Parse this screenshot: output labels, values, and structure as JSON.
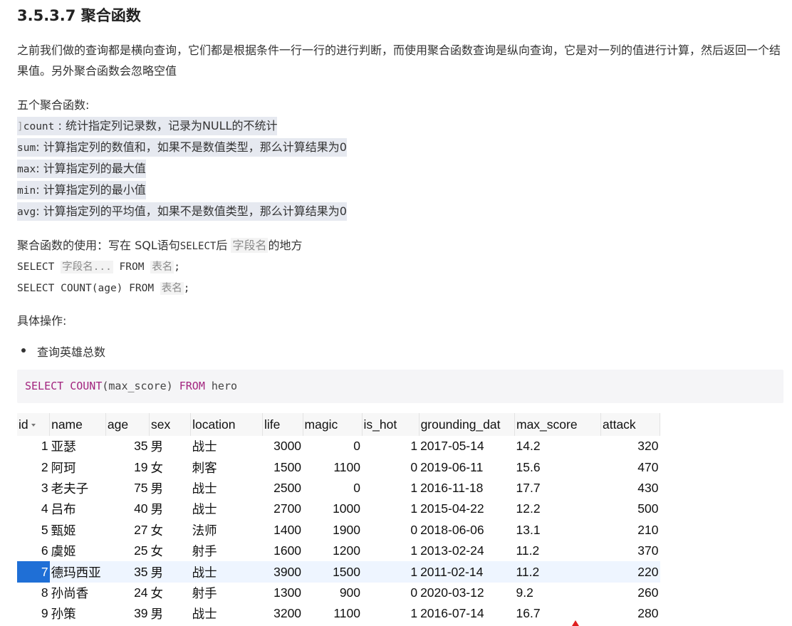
{
  "heading": "3.5.3.7 聚合函数",
  "intro": "之前我们做的查询都是横向查询，它们都是根据条件一行一行的进行判断，而使用聚合函数查询是纵向查询，它是对一列的值进行计算，然后返回一个结果值。另外聚合函数会忽略空值",
  "five_title": "五个聚合函数:",
  "functions": [
    {
      "name": "count",
      "sep": " :  ",
      "desc": "统计指定列记录数，记录为NULL的不统计"
    },
    {
      "name": "sum",
      "sep": ": ",
      "desc": "计算指定列的数值和，如果不是数值类型，那么计算结果为0"
    },
    {
      "name": "max",
      "sep": ": ",
      "desc": "计算指定列的最大值"
    },
    {
      "name": "min",
      "sep": ": ",
      "desc": "计算指定列的最小值"
    },
    {
      "name": "avg",
      "sep": ": ",
      "desc": "计算指定列的平均值，如果不是数值类型，那么计算结果为0"
    }
  ],
  "usage": {
    "prefix": "聚合函数的使用：写在 SQL语句",
    "select_kw": "SELECT",
    "after": "后 ",
    "field": "字段名",
    "suffix": "的地方"
  },
  "syntax1": {
    "select": "SELECT ",
    "fields": "字段名...",
    "from": " FROM ",
    "table": "表名",
    "end": ";"
  },
  "syntax2": {
    "select": "SELECT COUNT(age) FROM ",
    "table": "表名",
    "end": ";"
  },
  "ops_title": "具体操作:",
  "bullet": "查询英雄总数",
  "code": {
    "kw1": "SELECT",
    "fn": "COUNT",
    "arg": "(max_score) ",
    "kw2": "FROM",
    "tbl": " hero"
  },
  "table": {
    "columns": [
      "id",
      "name",
      "age",
      "sex",
      "location",
      "life",
      "magic",
      "is_hot",
      "grounding_dat",
      "max_score",
      "attack"
    ],
    "rows": [
      [
        "1",
        "亚瑟",
        "35",
        "男",
        "战士",
        "3000",
        "0",
        "1",
        "2017-05-14",
        "14.2",
        "320"
      ],
      [
        "2",
        "阿珂",
        "19",
        "女",
        "刺客",
        "1500",
        "1100",
        "0",
        "2019-06-11",
        "15.6",
        "470"
      ],
      [
        "3",
        "老夫子",
        "75",
        "男",
        "战士",
        "2500",
        "0",
        "1",
        "2016-11-18",
        "17.7",
        "430"
      ],
      [
        "4",
        "吕布",
        "40",
        "男",
        "战士",
        "2700",
        "1000",
        "1",
        "2015-04-22",
        "12.2",
        "500"
      ],
      [
        "5",
        "甄姬",
        "27",
        "女",
        "法师",
        "1400",
        "1900",
        "0",
        "2018-06-06",
        "13.1",
        "210"
      ],
      [
        "6",
        "虞姬",
        "25",
        "女",
        "射手",
        "1600",
        "1200",
        "1",
        "2013-02-24",
        "11.2",
        "370"
      ],
      [
        "7",
        "德玛西亚",
        "35",
        "男",
        "战士",
        "3900",
        "1500",
        "1",
        "2011-02-14",
        "11.2",
        "220"
      ],
      [
        "8",
        "孙尚香",
        "24",
        "女",
        "射手",
        "1300",
        "900",
        "0",
        "2020-03-12",
        "9.2",
        "260"
      ],
      [
        "9",
        "孙策",
        "39",
        "男",
        "战士",
        "3200",
        "1100",
        "1",
        "2016-07-14",
        "16.7",
        "280"
      ]
    ],
    "selected_row": 6,
    "accent": "#1f6fd6"
  }
}
